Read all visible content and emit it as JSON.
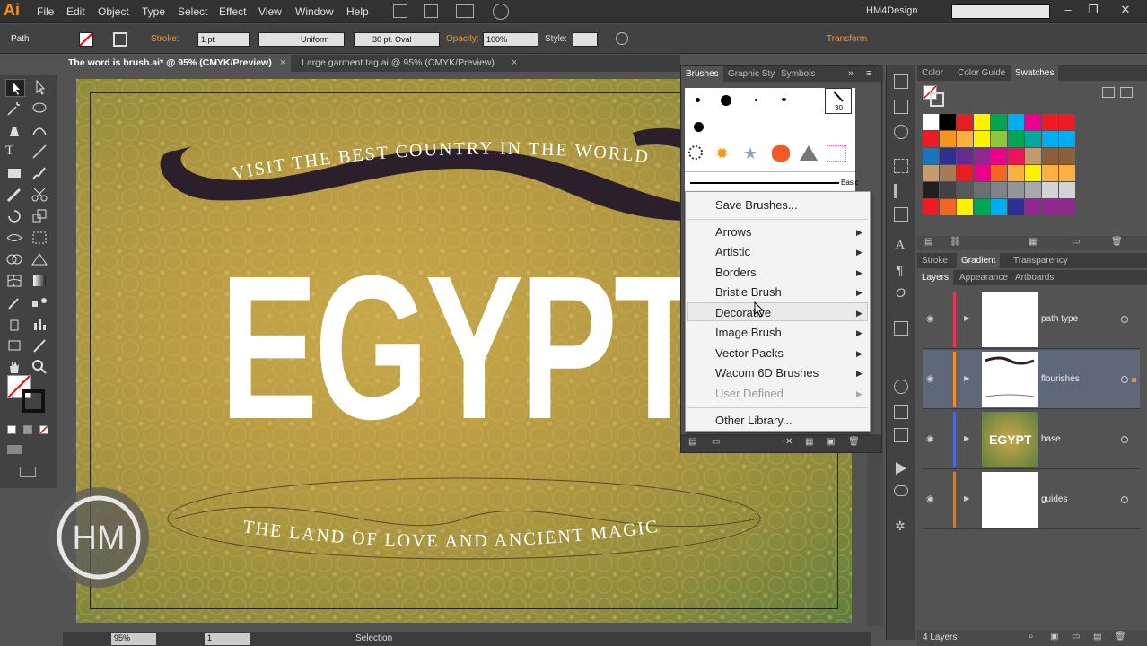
{
  "app": {
    "logo": "Ai",
    "workspace": "HM4Design"
  },
  "menu": [
    "File",
    "Edit",
    "Object",
    "Type",
    "Select",
    "Effect",
    "View",
    "Window",
    "Help"
  ],
  "control": {
    "selection_type": "Path",
    "stroke_label": "Stroke:",
    "stroke_weight": "1 pt",
    "profile": "Uniform",
    "brush": "30 pt. Oval",
    "opacity_label": "Opacity:",
    "opacity": "100%",
    "style_label": "Style:",
    "transform": "Transform"
  },
  "tabs": [
    {
      "label": "The word is brush.ai* @ 95% (CMYK/Preview)",
      "active": true
    },
    {
      "label": "Large garment tag.ai @ 95% (CMYK/Preview)",
      "active": false
    }
  ],
  "artwork": {
    "top_arc_text": "VISIT THE BEST COUNTRY IN THE WORLD",
    "headline": "EGYPT",
    "bottom_arc_text": "THE LAND OF LOVE AND ANCIENT MAGIC",
    "watermark": "HM"
  },
  "brushes_panel": {
    "tabs": [
      "Brushes",
      "Graphic Sty",
      "Symbols"
    ],
    "basic_label": "Basic",
    "size_label": "30"
  },
  "brush_menu": {
    "items": [
      {
        "label": "Save Brushes...",
        "submenu": false,
        "disabled": false
      },
      {
        "label": "Arrows",
        "submenu": true,
        "disabled": false
      },
      {
        "label": "Artistic",
        "submenu": true,
        "disabled": false
      },
      {
        "label": "Borders",
        "submenu": true,
        "disabled": false
      },
      {
        "label": "Bristle Brush",
        "submenu": true,
        "disabled": false
      },
      {
        "label": "Decorative",
        "submenu": true,
        "disabled": false,
        "hovered": true
      },
      {
        "label": "Image Brush",
        "submenu": true,
        "disabled": false
      },
      {
        "label": "Vector Packs",
        "submenu": true,
        "disabled": false
      },
      {
        "label": "Wacom 6D Brushes",
        "submenu": true,
        "disabled": false
      },
      {
        "label": "User Defined",
        "submenu": true,
        "disabled": true
      },
      {
        "label": "Other Library...",
        "submenu": false,
        "disabled": false
      }
    ]
  },
  "color_panel": {
    "tabs": [
      "Color",
      "Color Guide",
      "Swatches"
    ]
  },
  "gradient_tabs": [
    "Stroke",
    "Gradient",
    "Transparency"
  ],
  "layers_panel": {
    "tabs": [
      "Layers",
      "Appearance",
      "Artboards"
    ],
    "layers": [
      {
        "name": "path type",
        "color": "#e8365b",
        "thumb": "blank"
      },
      {
        "name": "flourishes",
        "color": "#f58d2a",
        "thumb": "flourish",
        "selected": true
      },
      {
        "name": "base",
        "color": "#4a6cd4",
        "thumb": "egypt",
        "thumb_text": "EGYPT"
      },
      {
        "name": "guides",
        "color": "#c08040",
        "thumb": "blank"
      }
    ],
    "count": "4 Layers"
  },
  "status": {
    "zoom": "95%",
    "artboard": "1",
    "tool": "Selection"
  },
  "swatch_colors": [
    [
      "#ffffff",
      "#000000",
      "#e31e24",
      "#fff200",
      "#00a651",
      "#00aeef",
      "#ec008c",
      "#ed1c24",
      "#ed1c24"
    ],
    [
      "#ed1c24",
      "#f7941d",
      "#fbb040",
      "#fff200",
      "#8dc63f",
      "#00a651",
      "#00a99d",
      "#00aeef",
      "#00aeef"
    ],
    [
      "#1b75bc",
      "#2e3192",
      "#662d91",
      "#92278f",
      "#ec008c",
      "#ed145b",
      "#c49a6c",
      "#8b5e3c",
      "#8b5e3c"
    ],
    [
      "#c69c6d",
      "#a67c52",
      "#ed1c24",
      "#ec008c",
      "#f26522",
      "#fbb040",
      "#fff200",
      "#fbb040",
      "#fbb040"
    ],
    [
      "#231f20",
      "#414042",
      "#58595b",
      "#6d6e71",
      "#808285",
      "#939598",
      "#a7a9ac",
      "#d1d3d4",
      "#d1d3d4"
    ],
    [
      "#ed1c24",
      "#f26522",
      "#fff200",
      "#00a651",
      "#00aeef",
      "#2e3192",
      "#92278f",
      "#92278f",
      "#92278f"
    ]
  ]
}
